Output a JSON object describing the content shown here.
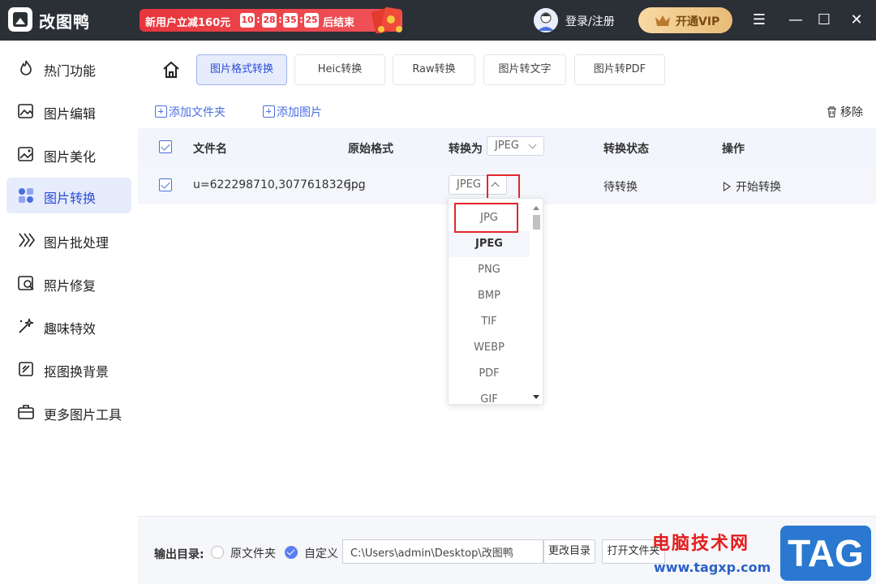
{
  "app": {
    "name": "改图鸭"
  },
  "promo": {
    "text": "新用户立减160元",
    "hours": "10",
    "minutes": "28",
    "seconds": "35",
    "centis": "25",
    "suffix": "后结束"
  },
  "header": {
    "login": "登录/注册",
    "vip": "开通VIP",
    "minimize": "☰",
    "min_glyph": "—",
    "max_glyph": "☐",
    "close_glyph": "✕"
  },
  "sidebar": {
    "items": [
      {
        "label": "热门功能",
        "icon": "flame-icon"
      },
      {
        "label": "图片编辑",
        "icon": "image-edit-icon"
      },
      {
        "label": "图片美化",
        "icon": "image-beauty-icon"
      },
      {
        "label": "图片转换",
        "icon": "convert-icon",
        "active": true
      },
      {
        "label": "图片批处理",
        "icon": "batch-icon"
      },
      {
        "label": "照片修复",
        "icon": "repair-icon"
      },
      {
        "label": "趣味特效",
        "icon": "magic-wand-icon"
      },
      {
        "label": "抠图换背景",
        "icon": "cutout-icon"
      },
      {
        "label": "更多图片工具",
        "icon": "toolbox-icon"
      }
    ]
  },
  "tabs": [
    {
      "label": "图片格式转换",
      "active": true
    },
    {
      "label": "Heic转换"
    },
    {
      "label": "Raw转换"
    },
    {
      "label": "图片转文字"
    },
    {
      "label": "图片转PDF"
    }
  ],
  "toolbar": {
    "add_folder": "添加文件夹",
    "add_image": "添加图片",
    "remove": "移除"
  },
  "table": {
    "headers": {
      "filename": "文件名",
      "original": "原始格式",
      "convert_to": "转换为",
      "status": "转换状态",
      "action": "操作"
    },
    "header_format": "JPEG",
    "rows": [
      {
        "filename": "u=622298710,3077618326...",
        "format": "jpg",
        "target": "JPEG",
        "status": "待转换",
        "action": "开始转换"
      }
    ]
  },
  "dropdown": {
    "options": [
      "JPG",
      "JPEG",
      "PNG",
      "BMP",
      "TIF",
      "WEBP",
      "PDF",
      "GIF"
    ],
    "selected": "JPEG"
  },
  "footer": {
    "label": "输出目录:",
    "option_original": "原文件夹",
    "option_custom": "自定义",
    "path": "C:\\Users\\admin\\Desktop\\改图鸭",
    "change_dir": "更改目录",
    "open_dir": "打开文件夹"
  },
  "watermark": {
    "text": "电脑技术网",
    "url": "www.tagxp.com",
    "tag": "TAG"
  },
  "colors": {
    "accent": "#2a4cd8",
    "titlebar": "#2b2f36",
    "highlight": "#e4262c"
  }
}
